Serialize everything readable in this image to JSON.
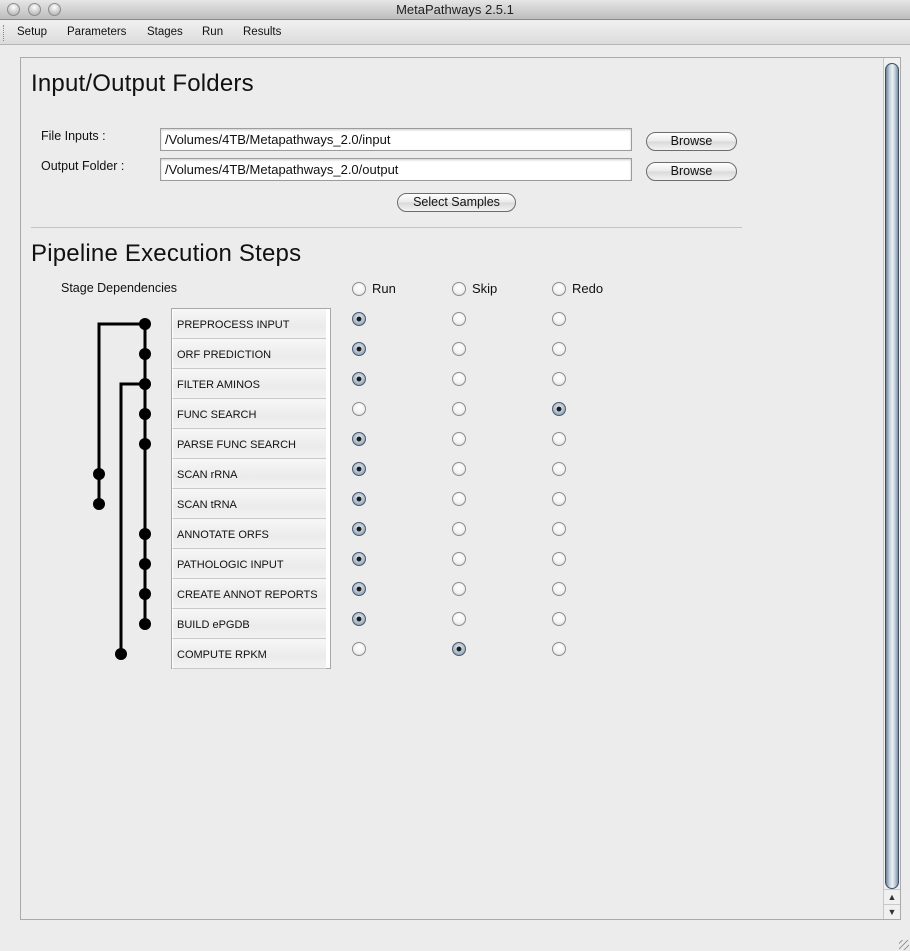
{
  "window": {
    "title": "MetaPathways 2.5.1"
  },
  "menu": {
    "items": [
      "Setup",
      "Parameters",
      "Stages",
      "Run",
      "Results"
    ]
  },
  "io_section": {
    "heading": "Input/Output Folders",
    "file_inputs_label": "File Inputs :",
    "file_inputs_value": "/Volumes/4TB/Metapathways_2.0/input",
    "output_folder_label": "Output Folder :",
    "output_folder_value": "/Volumes/4TB/Metapathways_2.0/output",
    "browse_label": "Browse",
    "select_samples_label": "Select Samples"
  },
  "pipeline": {
    "heading": "Pipeline Execution Steps",
    "dependencies_label": "Stage Dependencies",
    "columns": [
      "Run",
      "Skip",
      "Redo"
    ],
    "column_defaults": {
      "Run": false,
      "Skip": false,
      "Redo": false
    },
    "stages": [
      {
        "name": "PREPROCESS INPUT",
        "selected": "Run"
      },
      {
        "name": "ORF PREDICTION",
        "selected": "Run"
      },
      {
        "name": "FILTER AMINOS",
        "selected": "Run"
      },
      {
        "name": "FUNC SEARCH",
        "selected": "Redo"
      },
      {
        "name": "PARSE FUNC SEARCH",
        "selected": "Run"
      },
      {
        "name": "SCAN rRNA",
        "selected": "Run"
      },
      {
        "name": "SCAN tRNA",
        "selected": "Run"
      },
      {
        "name": "ANNOTATE ORFS",
        "selected": "Run"
      },
      {
        "name": "PATHOLOGIC INPUT",
        "selected": "Run"
      },
      {
        "name": "CREATE ANNOT REPORTS",
        "selected": "Run"
      },
      {
        "name": "BUILD ePGDB",
        "selected": "Run"
      },
      {
        "name": "COMPUTE RPKM",
        "selected": "Skip"
      }
    ],
    "dependencies": [
      {
        "from": "PREPROCESS INPUT",
        "to": [
          "SCAN rRNA",
          "SCAN tRNA"
        ]
      },
      {
        "from": "FILTER AMINOS",
        "to": [
          "COMPUTE RPKM"
        ]
      },
      {
        "from": "PREPROCESS INPUT",
        "to": [
          "ORF PREDICTION",
          "FILTER AMINOS",
          "FUNC SEARCH",
          "PARSE FUNC SEARCH",
          "ANNOTATE ORFS",
          "PATHOLOGIC INPUT",
          "CREATE ANNOT REPORTS",
          "BUILD ePGDB"
        ]
      }
    ]
  },
  "icons": {
    "scroll_up": "▲",
    "scroll_down": "▼"
  }
}
